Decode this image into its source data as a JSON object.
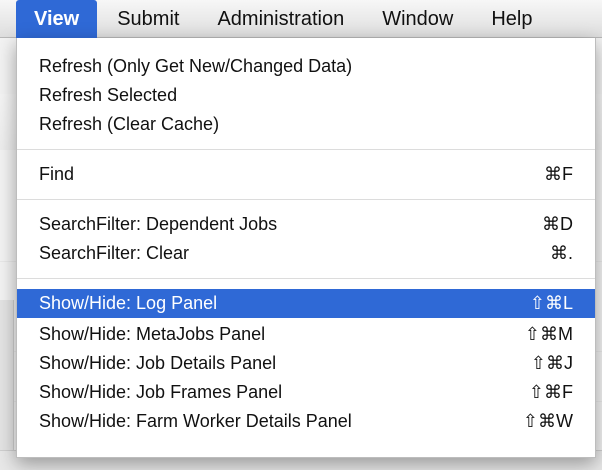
{
  "menubar": {
    "items": [
      {
        "label": "View",
        "active": true
      },
      {
        "label": "Submit"
      },
      {
        "label": "Administration"
      },
      {
        "label": "Window"
      },
      {
        "label": "Help"
      }
    ]
  },
  "view_menu": {
    "groups": [
      {
        "items": [
          {
            "label": "Refresh (Only Get New/Changed Data)",
            "shortcut": ""
          },
          {
            "label": "Refresh Selected",
            "shortcut": ""
          },
          {
            "label": "Refresh (Clear Cache)",
            "shortcut": ""
          }
        ]
      },
      {
        "items": [
          {
            "label": "Find",
            "shortcut": "⌘F"
          }
        ]
      },
      {
        "items": [
          {
            "label": "SearchFilter: Dependent Jobs",
            "shortcut": "⌘D"
          },
          {
            "label": "SearchFilter: Clear",
            "shortcut": "⌘."
          }
        ]
      },
      {
        "items": [
          {
            "label": "Show/Hide: Log Panel",
            "shortcut": "⇧⌘L",
            "highlighted": true
          },
          {
            "label": "Show/Hide: MetaJobs Panel",
            "shortcut": "⇧⌘M"
          },
          {
            "label": "Show/Hide: Job Details Panel",
            "shortcut": "⇧⌘J"
          },
          {
            "label": "Show/Hide: Job Frames Panel",
            "shortcut": "⇧⌘F"
          },
          {
            "label": "Show/Hide: Farm Worker Details Panel",
            "shortcut": "⇧⌘W"
          }
        ]
      }
    ]
  },
  "colors": {
    "highlight": "#2f69d6",
    "menu_bg": "#ffffff",
    "menubar_bg": "#e4e4e4"
  }
}
